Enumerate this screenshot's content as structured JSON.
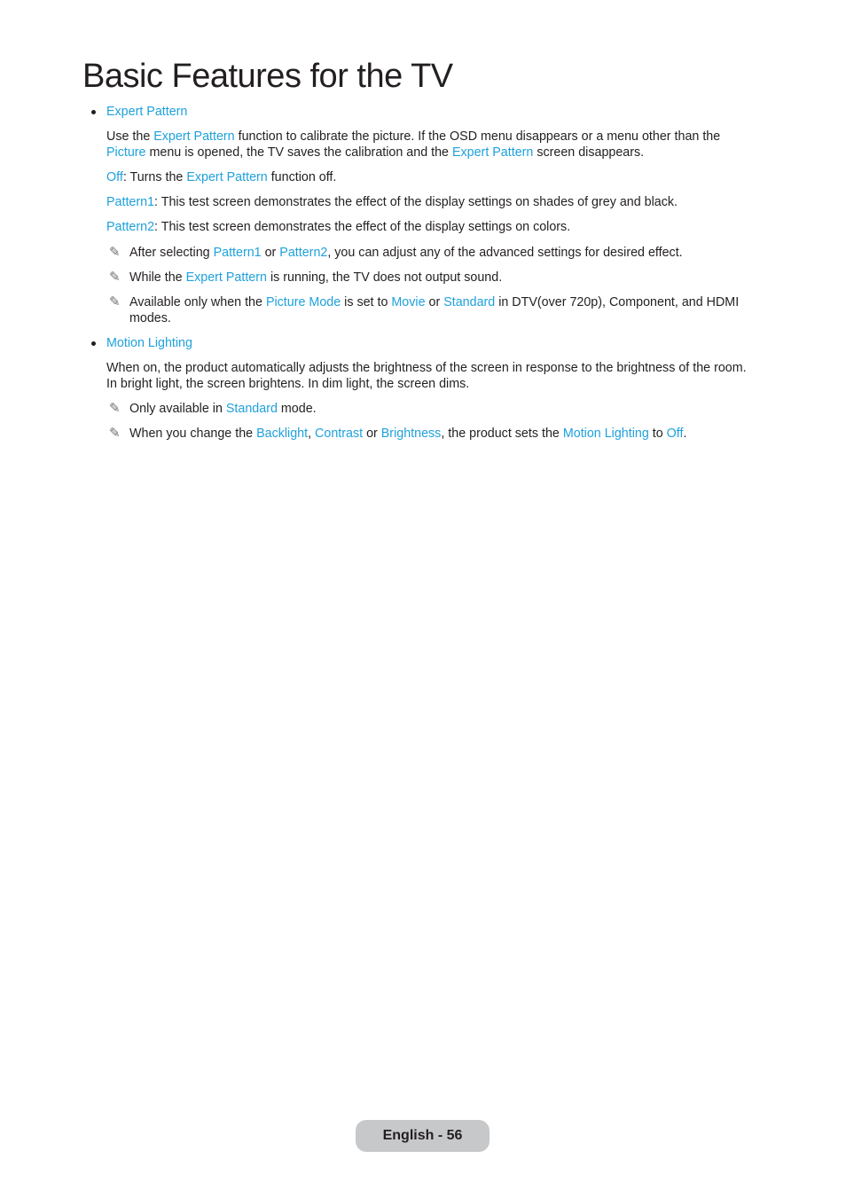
{
  "page": {
    "title": "Basic Features for the TV",
    "footer": "English - 56"
  },
  "sections": [
    {
      "heading": "Expert Pattern",
      "intro": {
        "p1": "Use the ",
        "h1": "Expert Pattern",
        "p2": " function to calibrate the picture. If the OSD menu disappears or a menu other than the ",
        "h2": "Picture",
        "p3": " menu is opened, the TV saves the calibration and the ",
        "h3": "Expert Pattern",
        "p4": " screen disappears."
      },
      "options": [
        {
          "name": "Off",
          "t1": ": Turns the ",
          "h1": "Expert Pattern",
          "t2": " function off."
        },
        {
          "name": "Pattern1",
          "t1": ": This test screen demonstrates the effect of the display settings on shades of grey and black."
        },
        {
          "name": "Pattern2",
          "t1": ": This test screen demonstrates the effect of the display settings on colors."
        }
      ],
      "notes": [
        {
          "t1": "After selecting ",
          "h1": "Pattern1",
          "t2": " or ",
          "h2": "Pattern2",
          "t3": ", you can adjust any of the advanced settings for desired effect."
        },
        {
          "t1": "While the ",
          "h1": "Expert Pattern",
          "t2": " is running, the TV does not output sound."
        },
        {
          "t1": "Available only when the ",
          "h1": "Picture Mode",
          "t2": " is set to ",
          "h2": "Movie",
          "t3": " or ",
          "h3": "Standard",
          "t4": " in DTV(over 720p), Component, and HDMI modes."
        }
      ]
    },
    {
      "heading": "Motion Lighting",
      "intro": "When on, the product automatically adjusts the brightness of the screen in response to the brightness of the room. In bright light, the screen brightens. In dim light, the screen dims.",
      "notes": [
        {
          "t1": "Only available in ",
          "h1": "Standard",
          "t2": " mode."
        },
        {
          "t1": "When you change the ",
          "h1": "Backlight",
          "t2": ", ",
          "h2": "Contrast",
          "t3": " or ",
          "h3": "Brightness",
          "t4": ", the product sets the ",
          "h4": "Motion Lighting",
          "t5": " to ",
          "h5": "Off",
          "t6": "."
        }
      ]
    }
  ],
  "icons": {
    "note": "pencil-note-icon"
  }
}
